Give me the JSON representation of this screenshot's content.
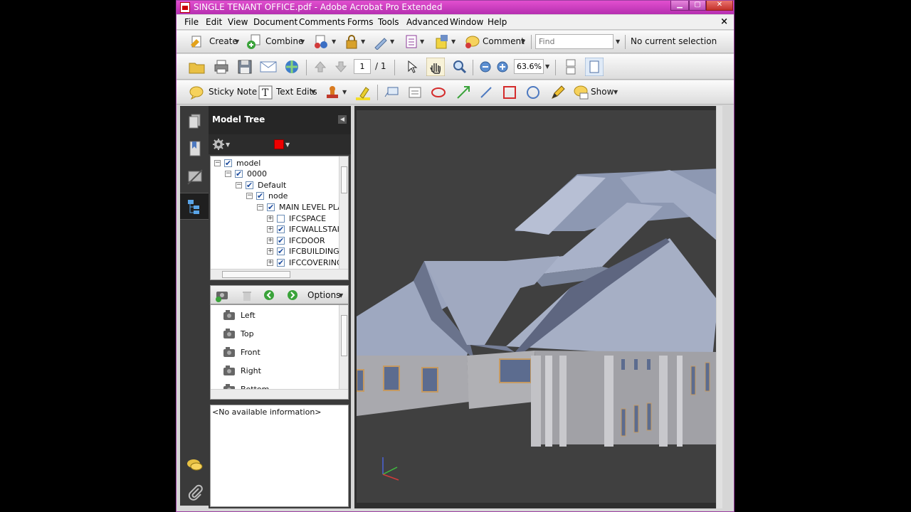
{
  "window": {
    "title": "SINGLE TENANT OFFICE.pdf - Adobe Acrobat Pro Extended"
  },
  "menu": [
    "File",
    "Edit",
    "View",
    "Document",
    "Comments",
    "Forms",
    "Tools",
    "Advanced",
    "Window",
    "Help"
  ],
  "toolbar1": {
    "create": "Create",
    "combine": "Combine",
    "comment": "Comment",
    "find_placeholder": "Find",
    "selection_status": "No current selection"
  },
  "toolbar2": {
    "page_current": "1",
    "page_total": "/ 1",
    "zoom": "63.6%"
  },
  "toolbar3": {
    "sticky_note": "Sticky Note",
    "text_edits": "Text Edits",
    "show": "Show"
  },
  "model_tree": {
    "title": "Model Tree",
    "items": [
      {
        "label": "model",
        "checked": true
      },
      {
        "label": "0000",
        "checked": true
      },
      {
        "label": "Default",
        "checked": true
      },
      {
        "label": "node",
        "checked": true
      },
      {
        "label": "MAIN LEVEL PLA",
        "checked": true
      },
      {
        "label": "IFCSPACE",
        "checked": false
      },
      {
        "label": "IFCWALLSTAI",
        "checked": true
      },
      {
        "label": "IFCDOOR",
        "checked": true
      },
      {
        "label": "IFCBUILDINGE",
        "checked": true
      },
      {
        "label": "IFCCOVERING",
        "checked": true
      }
    ]
  },
  "views": {
    "options": "Options",
    "items": [
      "Left",
      "Top",
      "Front",
      "Right",
      "Bottom"
    ]
  },
  "info": {
    "text": "<No available information>"
  },
  "colors": {
    "title_accent": "#c83fc0",
    "panel_dark": "#262626",
    "viewport_bg": "#404040",
    "roof": "#98a3bd"
  }
}
